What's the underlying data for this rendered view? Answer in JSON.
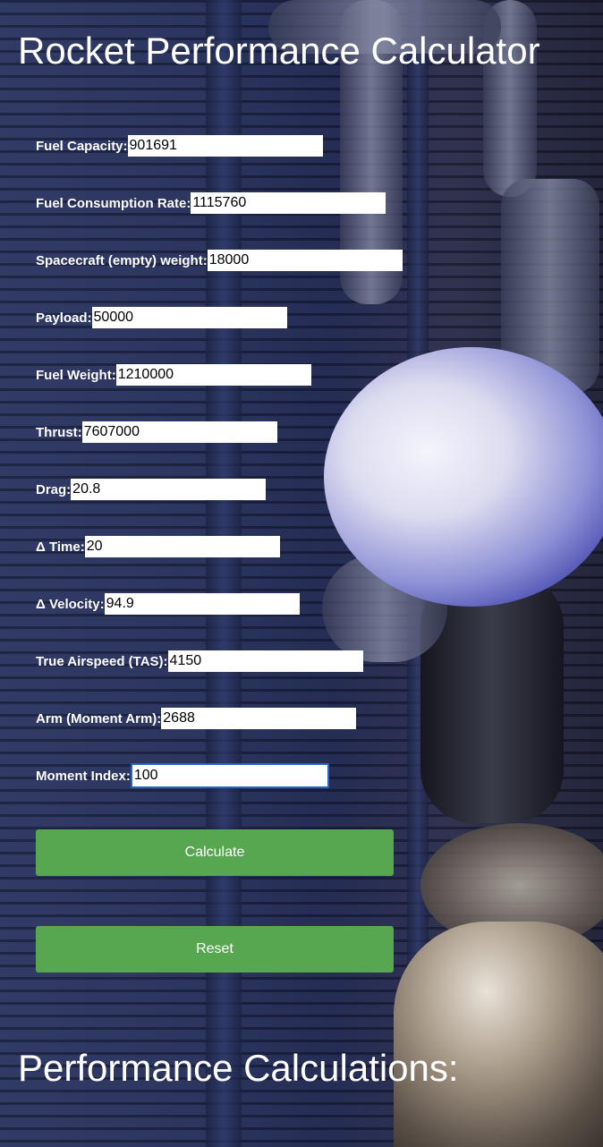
{
  "page": {
    "title": "Rocket Performance Calculator",
    "results_heading": "Performance Calculations:"
  },
  "form": {
    "fields": [
      {
        "label": "Fuel Capacity:",
        "value": "901691"
      },
      {
        "label": "Fuel Consumption Rate:",
        "value": "1115760"
      },
      {
        "label": "Spacecraft (empty) weight:",
        "value": "18000"
      },
      {
        "label": "Payload:",
        "value": "50000"
      },
      {
        "label": "Fuel Weight:",
        "value": "1210000"
      },
      {
        "label": "Thrust:",
        "value": "7607000"
      },
      {
        "label": "Drag:",
        "value": "20.8"
      },
      {
        "label": "Δ Time:",
        "value": "20"
      },
      {
        "label": "Δ Velocity:",
        "value": "94.9"
      },
      {
        "label": "True Airspeed (TAS):",
        "value": "4150"
      },
      {
        "label": "Arm (Moment Arm):",
        "value": "2688"
      },
      {
        "label": "Moment Index:",
        "value": "100"
      }
    ]
  },
  "buttons": {
    "calculate_label": "Calculate",
    "reset_label": "Reset"
  },
  "colors": {
    "button": "#57a650",
    "focus_border": "#2a63c7",
    "text": "#ffffff"
  }
}
